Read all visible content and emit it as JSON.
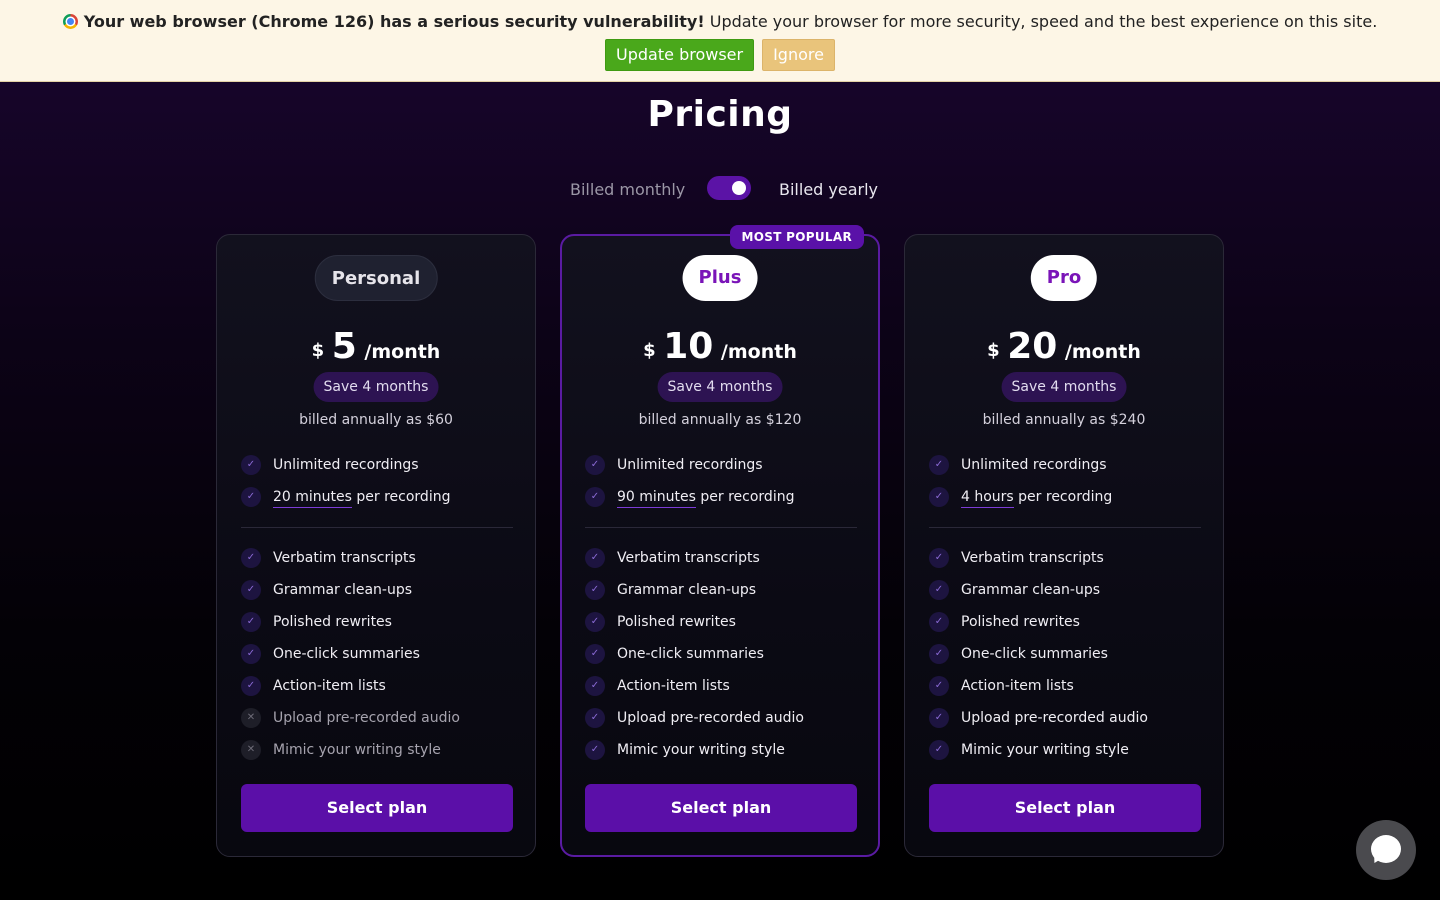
{
  "banner": {
    "bold_text": "Your web browser (Chrome 126) has a serious security vulnerability!",
    "text": " Update your browser for more security, speed and the best experience on this site.",
    "update_label": "Update browser",
    "ignore_label": "Ignore"
  },
  "page": {
    "title": "Pricing"
  },
  "billing": {
    "monthly_label": "Billed monthly",
    "yearly_label": "Billed yearly",
    "yearly_selected": true
  },
  "plans": [
    {
      "name": "Personal",
      "currency": "$",
      "amount": "5",
      "period": "/month",
      "save": "Save 4 months",
      "billed": "billed annually as $60",
      "limit_highlight": "20 minutes",
      "limit_rest": " per recording",
      "features": [
        "Unlimited recordings",
        "Verbatim transcripts",
        "Grammar clean-ups",
        "Polished rewrites",
        "One-click summaries",
        "Action-item lists",
        "Upload pre-recorded audio",
        "Mimic your writing style"
      ],
      "button": "Select plan"
    },
    {
      "name": "Plus",
      "badge": "MOST POPULAR",
      "currency": "$",
      "amount": "10",
      "period": "/month",
      "save": "Save 4 months",
      "billed": "billed annually as $120",
      "limit_highlight": "90 minutes",
      "limit_rest": " per recording",
      "features": [
        "Unlimited recordings",
        "Verbatim transcripts",
        "Grammar clean-ups",
        "Polished rewrites",
        "One-click summaries",
        "Action-item lists",
        "Upload pre-recorded audio",
        "Mimic your writing style"
      ],
      "button": "Select plan"
    },
    {
      "name": "Pro",
      "currency": "$",
      "amount": "20",
      "period": "/month",
      "save": "Save 4 months",
      "billed": "billed annually as $240",
      "limit_highlight": "4 hours",
      "limit_rest": " per recording",
      "features": [
        "Unlimited recordings",
        "Verbatim transcripts",
        "Grammar clean-ups",
        "Polished rewrites",
        "One-click summaries",
        "Action-item lists",
        "Upload pre-recorded audio",
        "Mimic your writing style"
      ],
      "button": "Select plan"
    }
  ],
  "icons": {
    "check": "check-icon",
    "cross": "cross-icon",
    "chat": "chat-bubble-icon",
    "browser": "chrome-logo-icon"
  },
  "colors": {
    "accent": "#5b0fa8",
    "update_green": "#4aa81b",
    "ignore_tan": "#e9c47b",
    "plus_name": "#7a14b8"
  }
}
